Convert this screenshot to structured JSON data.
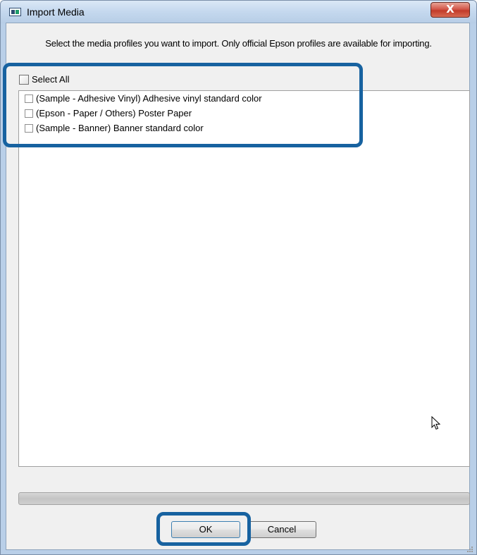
{
  "window": {
    "title": "Import Media",
    "close_label": "X",
    "app_icon": "window-app-icon"
  },
  "dialog": {
    "instruction": "Select the media profiles you want to import. Only official Epson profiles are available for importing.",
    "select_all_label": "Select All",
    "select_all_checked": false,
    "profiles": [
      {
        "label": "(Sample - Adhesive Vinyl) Adhesive vinyl standard color",
        "checked": false
      },
      {
        "label": "(Epson - Paper / Others) Poster Paper",
        "checked": false
      },
      {
        "label": "(Sample - Banner) Banner standard color",
        "checked": false
      }
    ],
    "progress": 0
  },
  "buttons": {
    "ok": "OK",
    "cancel": "Cancel"
  },
  "colors": {
    "highlight": "#1762a0",
    "titlebar": "#c4d8ee",
    "close_button": "#c23b2a"
  }
}
